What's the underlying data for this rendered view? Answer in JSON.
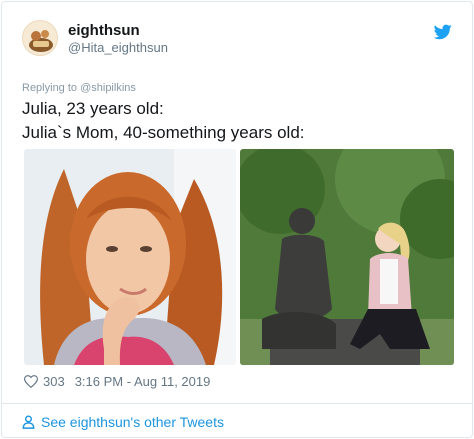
{
  "user": {
    "display_name": "eighthsun",
    "handle": "@Hita_eighthsun"
  },
  "tweet": {
    "reply_to": "Replying to @shipilkins",
    "text_line1": "Julia, 23 years old:",
    "text_line2": "Julia`s Mom, 40-something years old:"
  },
  "meta": {
    "likes": "303",
    "timestamp": "3:16 PM - Aug 11, 2019"
  },
  "footer": {
    "link_text": "See eighthsun's other Tweets"
  },
  "icons": {
    "brand": "twitter-bird-icon",
    "like": "heart-icon",
    "profile": "person-icon"
  },
  "colors": {
    "twitter_blue": "#1da1f2",
    "link_blue": "#1b95e0",
    "secondary_text": "#657786",
    "border": "#e1e8ed"
  }
}
